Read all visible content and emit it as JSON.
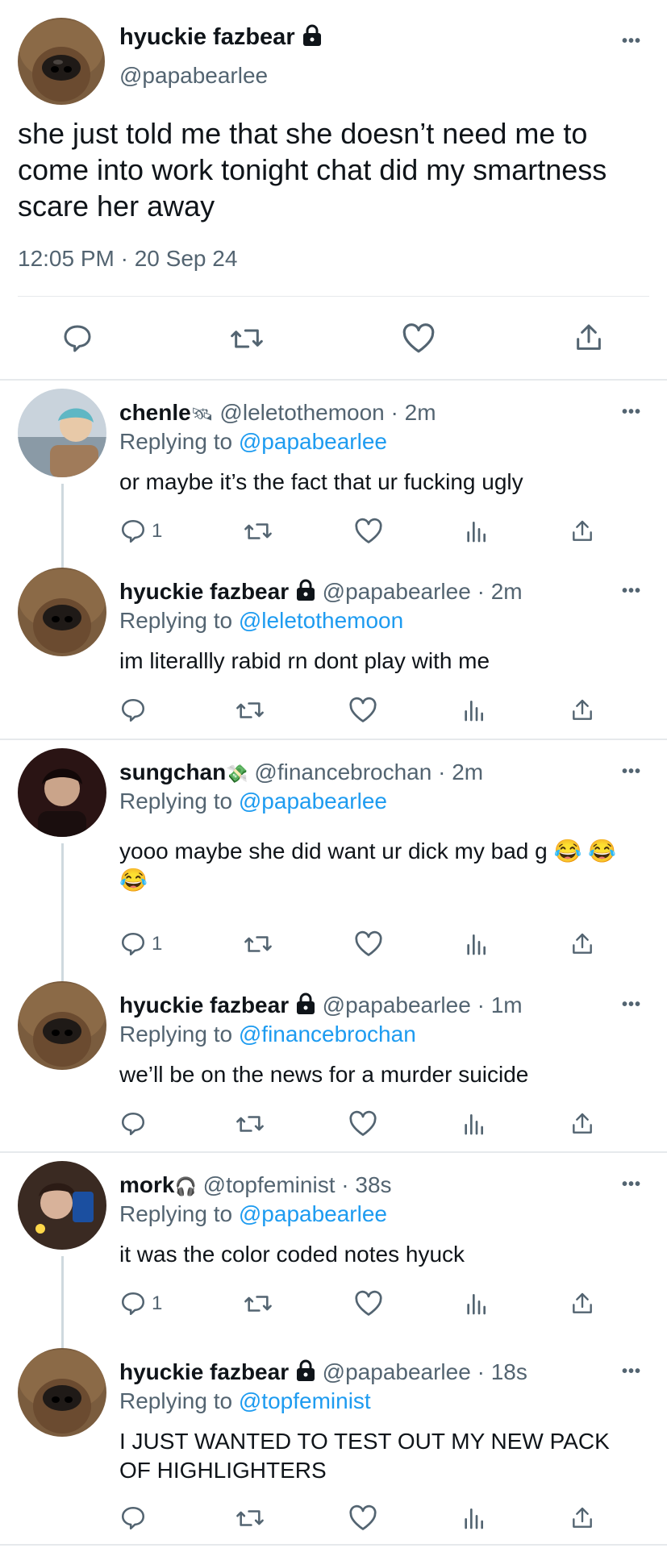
{
  "main_tweet": {
    "display_name": "hyuckie fazbear",
    "handle": "@papabearlee",
    "text": "she just told me that she doesn’t need me to come into work tonight chat did my smartness scare her away",
    "timestamp": "12:05 PM · 20 Sep 24",
    "avatar": "bear-nose-avatar",
    "icons": [
      "lock-icon",
      "more-icon",
      "reply-icon",
      "retweet-icon",
      "like-icon",
      "share-icon"
    ]
  },
  "replies": [
    {
      "display_name": "chenle",
      "name_emoji": "🛰",
      "handle": "@leletothemoon",
      "time": "2m",
      "replying_label": "Replying to",
      "replying_to": "@papabearlee",
      "text": "or maybe it’s the fact that ur fucking ugly",
      "reply_count": "1",
      "avatar": "teal-hair-avatar"
    },
    {
      "display_name": "hyuckie fazbear",
      "handle": "@papabearlee",
      "time": "2m",
      "replying_label": "Replying to",
      "replying_to": "@leletothemoon",
      "text": "im literallly rabid rn dont play with me",
      "reply_count": "",
      "avatar": "bear-nose-avatar"
    },
    {
      "display_name": "sungchan",
      "name_emoji": "💸",
      "handle": "@financebrochan",
      "time": "2m",
      "replying_label": "Replying to",
      "replying_to": "@papabearlee",
      "text": "yooo maybe she did want ur dick my bad g 😂 😂 😂",
      "reply_count": "1",
      "avatar": "dark-portrait-avatar"
    },
    {
      "display_name": "hyuckie fazbear",
      "handle": "@papabearlee",
      "time": "1m",
      "replying_label": "Replying to",
      "replying_to": "@financebrochan",
      "text": "we’ll be on the news for a murder suicide",
      "reply_count": "",
      "avatar": "bear-nose-avatar"
    },
    {
      "display_name": "mork",
      "name_emoji": "🎧",
      "handle": "@topfeminist",
      "time": "38s",
      "replying_label": "Replying to",
      "replying_to": "@papabearlee",
      "text": "it was the color coded notes hyuck",
      "reply_count": "1",
      "avatar": "phone-selfie-avatar"
    },
    {
      "display_name": "hyuckie fazbear",
      "handle": "@papabearlee",
      "time": "18s",
      "replying_label": "Replying to",
      "replying_to": "@topfeminist",
      "text": "I JUST WANTED TO TEST OUT MY NEW PACK OF HIGHLIGHTERS",
      "reply_count": "",
      "avatar": "bear-nose-avatar"
    }
  ],
  "colors": {
    "link": "#1d9bf0",
    "secondary_text": "#536471",
    "primary_text": "#0f1419",
    "divider": "#e6e9ec"
  }
}
